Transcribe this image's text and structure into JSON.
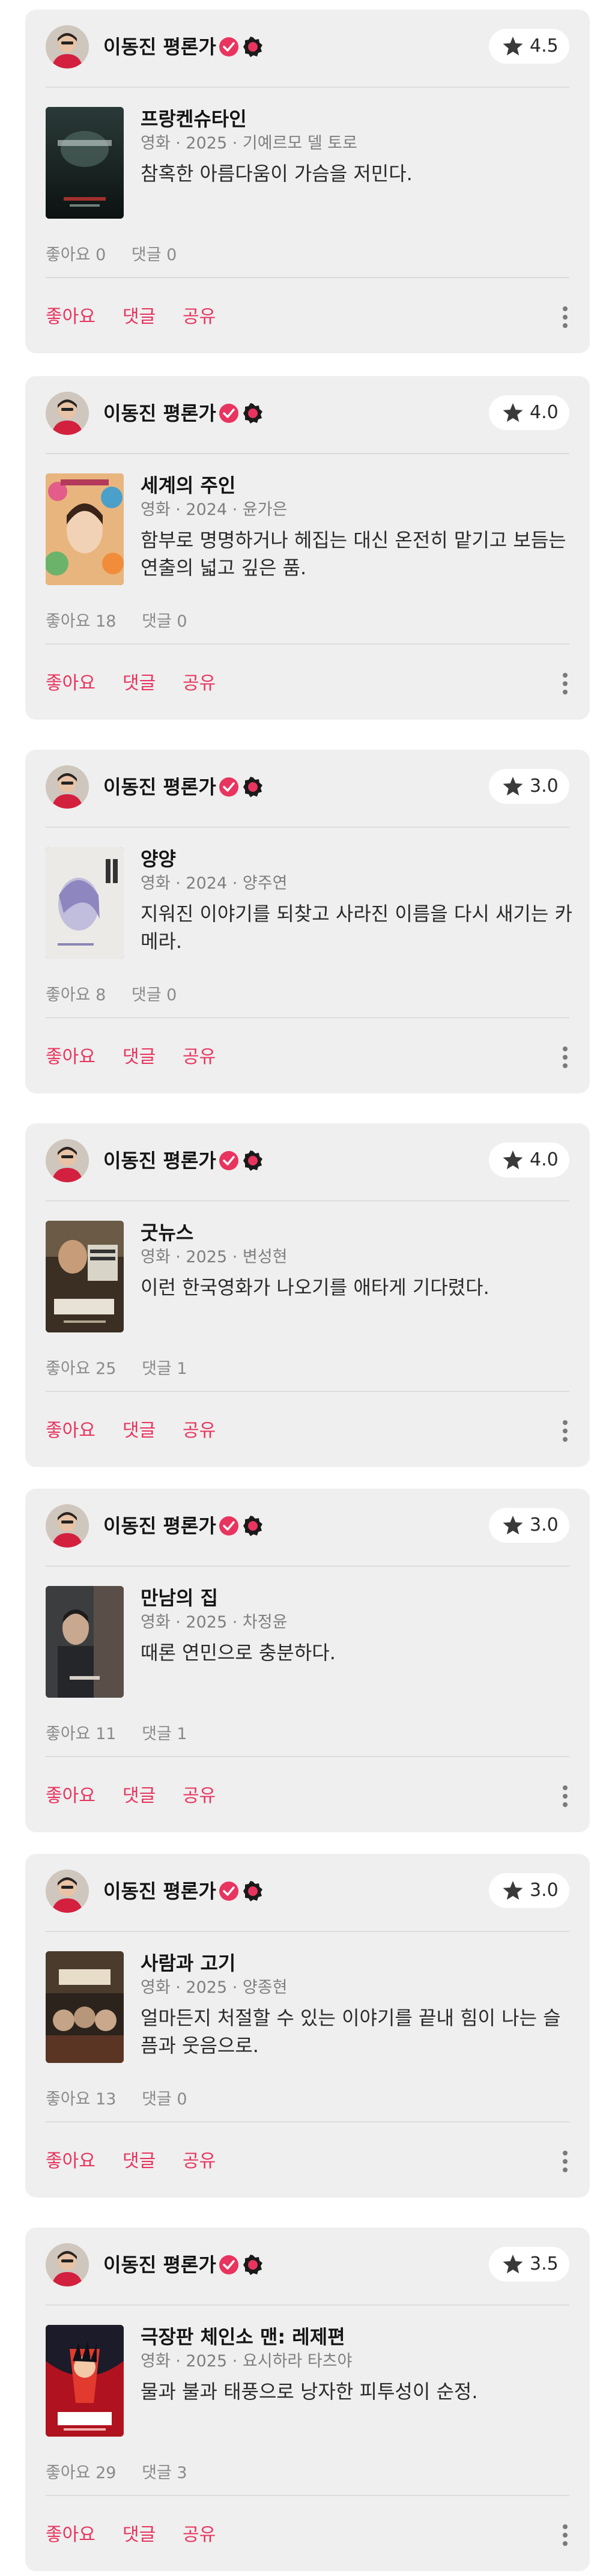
{
  "colors": {
    "accent": "#e8345e",
    "card_bg": "#efefef",
    "meta": "#7f7f7f"
  },
  "actions": {
    "like": "좋아요",
    "comment": "댓글",
    "share": "공유"
  },
  "reviews": [
    {
      "author": "이동진 평론가",
      "rating": "4.5",
      "title": "프랑켄슈타인",
      "meta": "영화 · 2025 · 기예르모 델 토로",
      "text": "참혹한 아름다움이 가슴을 저민다.",
      "likes": "좋아요 0",
      "comments": "댓글 0",
      "poster_icon": "poster-frankenstein"
    },
    {
      "author": "이동진 평론가",
      "rating": "4.0",
      "title": "세계의 주인",
      "meta": "영화 · 2024 · 윤가은",
      "text": "함부로 명명하거나 헤집는 대신 온전히 맡기고 보듬는 연출의 넓고 깊은 품.",
      "likes": "좋아요 18",
      "comments": "댓글 0",
      "poster_icon": "poster-world-owner"
    },
    {
      "author": "이동진 평론가",
      "rating": "3.0",
      "title": "양양",
      "meta": "영화 · 2024 · 양주연",
      "text": "지워진 이야기를 되찾고 사라진 이름을 다시 새기는 카메라.",
      "likes": "좋아요 8",
      "comments": "댓글 0",
      "poster_icon": "poster-yangyang"
    },
    {
      "author": "이동진 평론가",
      "rating": "4.0",
      "title": "굿뉴스",
      "meta": "영화 · 2025 · 변성현",
      "text": "이런 한국영화가 나오기를 애타게 기다렸다.",
      "likes": "좋아요 25",
      "comments": "댓글 1",
      "poster_icon": "poster-good-news"
    },
    {
      "author": "이동진 평론가",
      "rating": "3.0",
      "title": "만남의 집",
      "meta": "영화 · 2025 · 차정윤",
      "text": "때론 연민으로 충분하다.",
      "likes": "좋아요 11",
      "comments": "댓글 1",
      "poster_icon": "poster-house-of-meeting"
    },
    {
      "author": "이동진 평론가",
      "rating": "3.0",
      "title": "사람과 고기",
      "meta": "영화 · 2025 · 양종현",
      "text": "얼마든지 처절할 수 있는 이야기를 끝내 힘이 나는 슬픔과 웃음으로.",
      "likes": "좋아요 13",
      "comments": "댓글 0",
      "poster_icon": "poster-people-and-meat"
    },
    {
      "author": "이동진 평론가",
      "rating": "3.5",
      "title": "극장판 체인소 맨: 레제편",
      "meta": "영화 · 2025 · 요시하라 타츠야",
      "text": "물과 불과 태풍으로 낭자한 피투성이 순정.",
      "likes": "좋아요 29",
      "comments": "댓글 3",
      "poster_icon": "poster-chainsaw-man"
    }
  ]
}
